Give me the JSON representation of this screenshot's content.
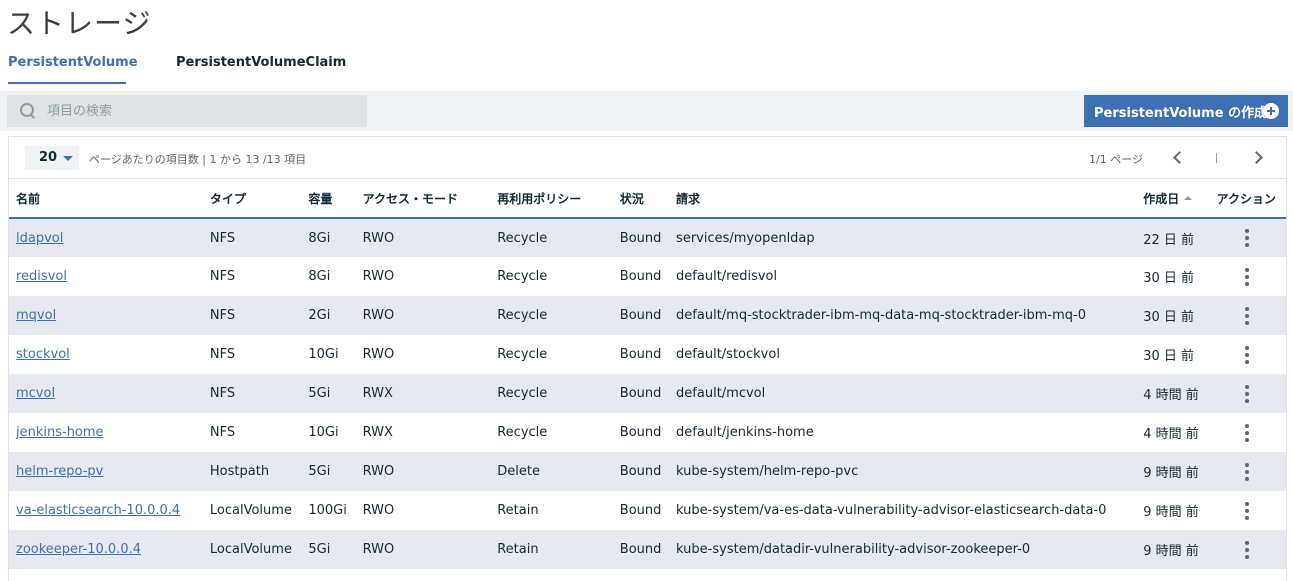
{
  "page": {
    "title": "ストレージ"
  },
  "tabs": [
    {
      "label": "PersistentVolume",
      "active": true
    },
    {
      "label": "PersistentVolumeClaim",
      "active": false
    }
  ],
  "toolbar": {
    "search_placeholder": "項目の検索",
    "create_label": "PersistentVolume の作成"
  },
  "pagination": {
    "page_size": "20",
    "items_text": "ページあたりの項目数 | 1 から 13 /13 項目",
    "page_info": "1/1 ページ"
  },
  "table": {
    "columns": [
      "名前",
      "タイプ",
      "容量",
      "アクセス・モード",
      "再利用ポリシー",
      "状況",
      "請求",
      "作成日",
      "アクション"
    ],
    "rows": [
      {
        "name": "ldapvol",
        "type": "NFS",
        "capacity": "8Gi",
        "access": "RWO",
        "policy": "Recycle",
        "status": "Bound",
        "claim": "services/myopenldap",
        "created": "22 日 前"
      },
      {
        "name": "redisvol",
        "type": "NFS",
        "capacity": "8Gi",
        "access": "RWO",
        "policy": "Recycle",
        "status": "Bound",
        "claim": "default/redisvol",
        "created": "30 日 前"
      },
      {
        "name": "mqvol",
        "type": "NFS",
        "capacity": "2Gi",
        "access": "RWO",
        "policy": "Recycle",
        "status": "Bound",
        "claim": "default/mq-stocktrader-ibm-mq-data-mq-stocktrader-ibm-mq-0",
        "created": "30 日 前"
      },
      {
        "name": "stockvol",
        "type": "NFS",
        "capacity": "10Gi",
        "access": "RWO",
        "policy": "Recycle",
        "status": "Bound",
        "claim": "default/stockvol",
        "created": "30 日 前"
      },
      {
        "name": "mcvol",
        "type": "NFS",
        "capacity": "5Gi",
        "access": "RWX",
        "policy": "Recycle",
        "status": "Bound",
        "claim": "default/mcvol",
        "created": "4 時間 前"
      },
      {
        "name": "jenkins-home",
        "type": "NFS",
        "capacity": "10Gi",
        "access": "RWX",
        "policy": "Recycle",
        "status": "Bound",
        "claim": "default/jenkins-home",
        "created": "4 時間 前"
      },
      {
        "name": "helm-repo-pv",
        "type": "Hostpath",
        "capacity": "5Gi",
        "access": "RWO",
        "policy": "Delete",
        "status": "Bound",
        "claim": "kube-system/helm-repo-pvc",
        "created": "9 時間 前"
      },
      {
        "name": "va-elasticsearch-10.0.0.4",
        "type": "LocalVolume",
        "capacity": "100Gi",
        "access": "RWO",
        "policy": "Retain",
        "status": "Bound",
        "claim": "kube-system/va-es-data-vulnerability-advisor-elasticsearch-data-0",
        "created": "9 時間 前"
      },
      {
        "name": "zookeeper-10.0.0.4",
        "type": "LocalVolume",
        "capacity": "5Gi",
        "access": "RWO",
        "policy": "Retain",
        "status": "Bound",
        "claim": "kube-system/datadir-vulnerability-advisor-zookeeper-0",
        "created": "9 時間 前"
      }
    ]
  }
}
